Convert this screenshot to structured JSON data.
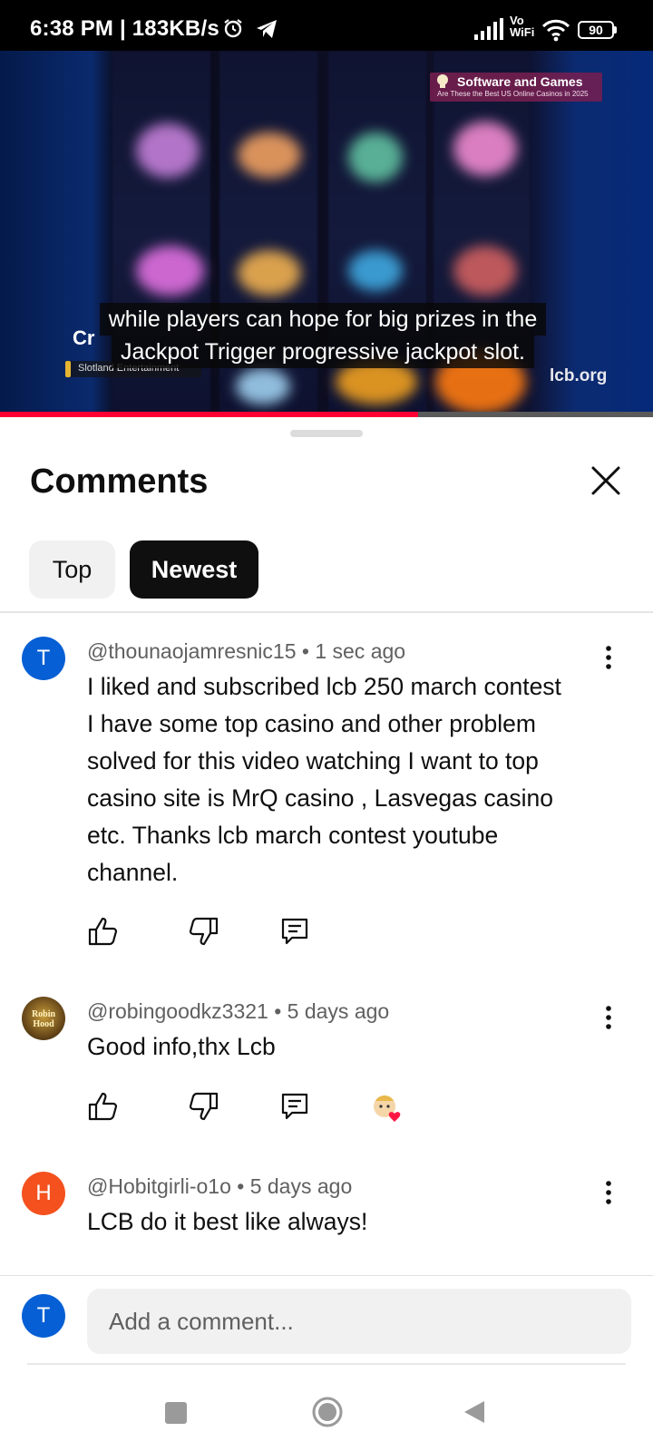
{
  "status_bar": {
    "time": "6:38 PM | 183KB/s",
    "network_label": "Vo\nWiFi",
    "battery": "90"
  },
  "video": {
    "badge_title": "Software and Games",
    "badge_subtitle": "Are These the Best US Online Casinos in 2025",
    "caption_line1": "while players can hope for big prizes in the",
    "caption_line2": "Jackpot Trigger progressive jackpot slot.",
    "cr_text": "Cr",
    "provider_label": "Slotland Entertainment",
    "watermark": "lcb.org",
    "progress": 0.64,
    "colors": {
      "progress": "#ff0033"
    }
  },
  "comments_panel": {
    "title": "Comments",
    "filters": [
      {
        "label": "Top",
        "selected": false
      },
      {
        "label": "Newest",
        "selected": true
      }
    ],
    "comments": [
      {
        "avatar_letter": "T",
        "avatar_color": "#065fd4",
        "author": "@thounaojamresnic15",
        "time": "1 sec ago",
        "text_lines": [
          "I liked and subscribed lcb 250 march contest",
          "I have some top casino and other problem",
          "solved for this video watching I want to top",
          "casino site is MrQ casino , Lasvegas casino",
          "etc. Thanks lcb march contest youtube",
          "channel."
        ]
      },
      {
        "avatar_letter": "",
        "avatar_color": "#7a5a2a",
        "avatar_logo_text": "Robin Hood",
        "author": "@robingoodkz3321",
        "time": "5 days ago",
        "text_lines": [
          "Good info,thx Lcb"
        ],
        "creator_heart": true
      },
      {
        "avatar_letter": "H",
        "avatar_color": "#f4511e",
        "author": "@Hobitgirli-o1o",
        "time": "5 days ago",
        "text_lines": [
          "LCB do it best like always!"
        ]
      }
    ],
    "input": {
      "avatar_letter": "T",
      "placeholder": "Add a comment..."
    },
    "separator": "•"
  }
}
